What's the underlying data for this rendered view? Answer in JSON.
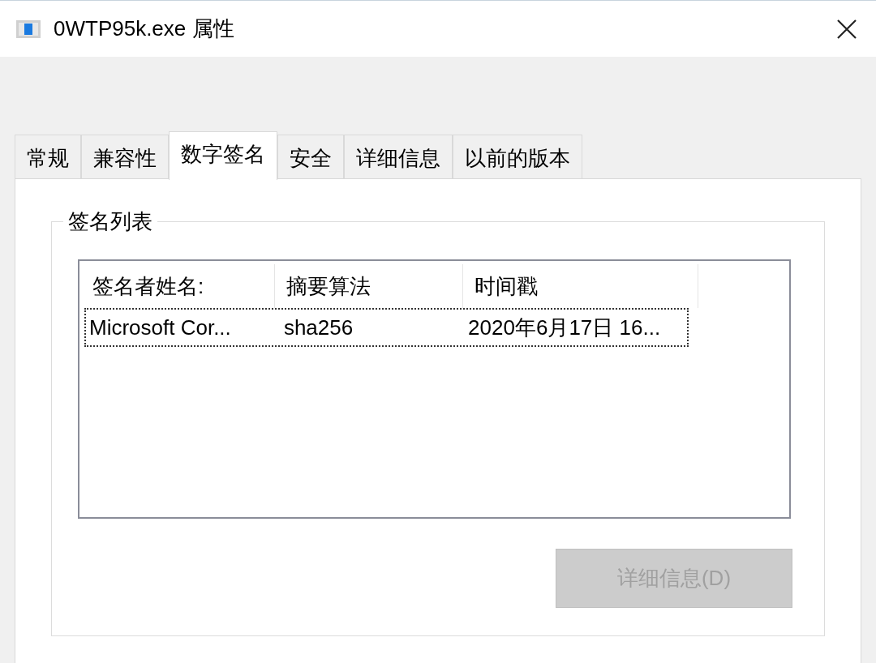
{
  "window": {
    "title": "0WTP95k.exe 属性"
  },
  "tabs": [
    {
      "label": "常规",
      "selected": false
    },
    {
      "label": "兼容性",
      "selected": false
    },
    {
      "label": "数字签名",
      "selected": true
    },
    {
      "label": "安全",
      "selected": false
    },
    {
      "label": "详细信息",
      "selected": false
    },
    {
      "label": "以前的版本",
      "selected": false
    }
  ],
  "group": {
    "title": "签名列表"
  },
  "table": {
    "columns": [
      "签名者姓名:",
      "摘要算法",
      "时间戳"
    ],
    "rows": [
      {
        "cells": [
          "Microsoft Cor...",
          "sha256",
          "2020年6月17日 16..."
        ],
        "focused": true
      }
    ]
  },
  "details_button": {
    "label": "详细信息(D)",
    "disabled": true
  }
}
